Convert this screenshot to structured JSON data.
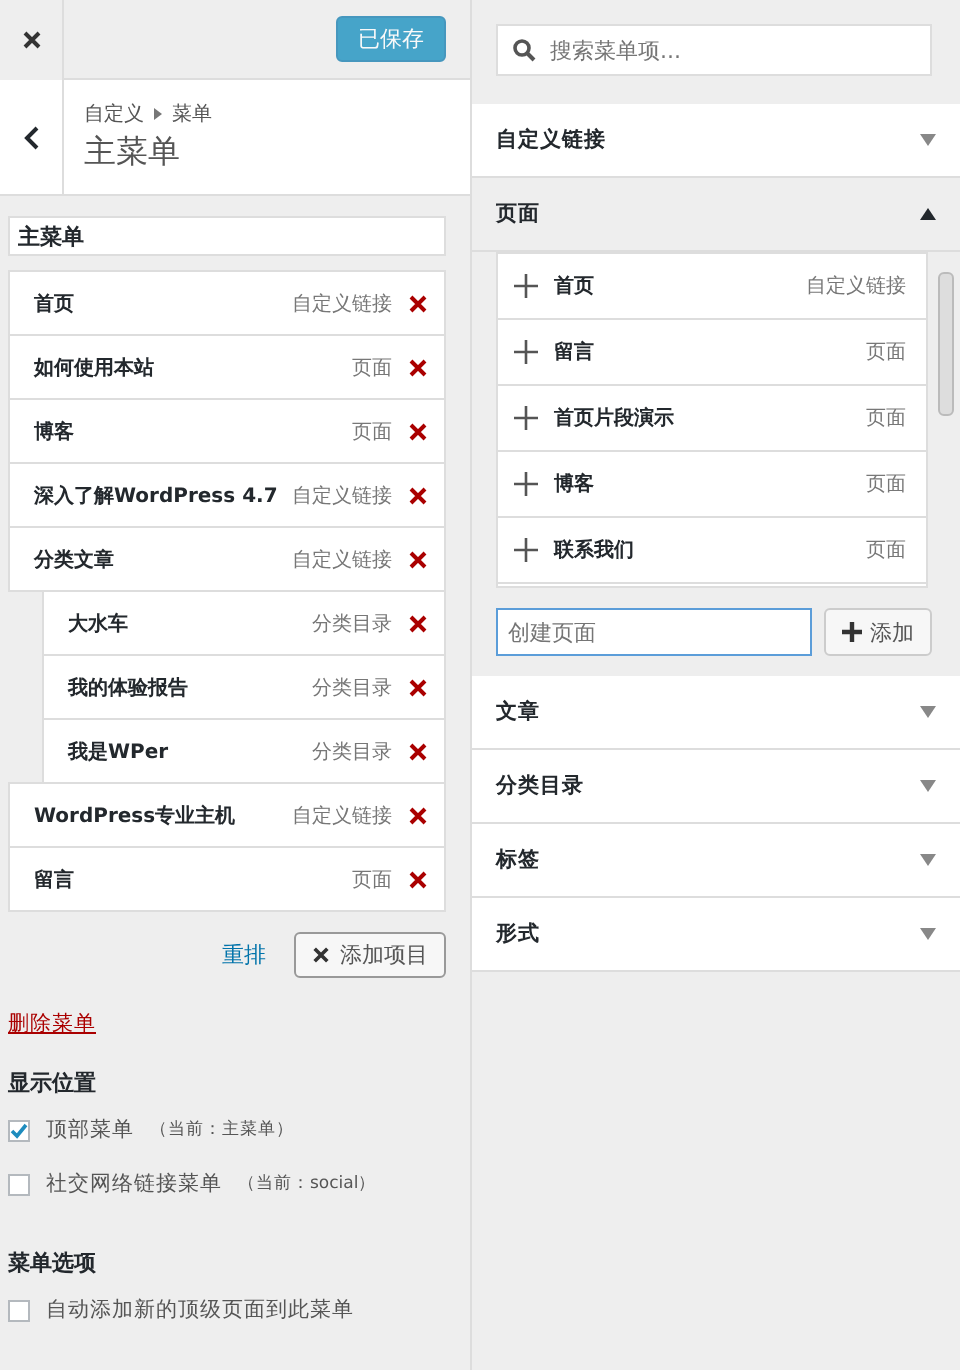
{
  "header": {
    "save_button": {
      "label": "已保存",
      "disabled": true
    }
  },
  "breadcrumb": {
    "parent": "自定义",
    "current": "菜单"
  },
  "title": "主菜单",
  "menu_name": {
    "value": "主菜单"
  },
  "menu_items": [
    {
      "title": "首页",
      "type": "自定义链接"
    },
    {
      "title": "如何使用本站",
      "type": "页面"
    },
    {
      "title": "博客",
      "type": "页面"
    },
    {
      "title": "深入了解WordPress 4.7",
      "type": "自定义链接"
    },
    {
      "title": "分类文章",
      "type": "自定义链接",
      "children": [
        {
          "title": "大水车",
          "type": "分类目录"
        },
        {
          "title": "我的体验报告",
          "type": "分类目录"
        },
        {
          "title": "我是WPer",
          "type": "分类目录"
        }
      ]
    },
    {
      "title": "WordPress专业主机",
      "type": "自定义链接"
    },
    {
      "title": "留言",
      "type": "页面"
    }
  ],
  "menu_actions": {
    "reorder": "重排",
    "add_items": "添加项目"
  },
  "delete_menu": "删除菜单",
  "display_location": {
    "heading": "显示位置",
    "locations": [
      {
        "label": "顶部菜单",
        "note": "（当前：主菜单）",
        "checked": true
      },
      {
        "label": "社交网络链接菜单",
        "note": "（当前：social）",
        "checked": false
      }
    ]
  },
  "menu_options": {
    "heading": "菜单选项",
    "options": [
      {
        "label": "自动添加新的顶级页面到此菜单",
        "checked": false
      }
    ]
  },
  "search": {
    "placeholder": "搜索菜单项..."
  },
  "sections": [
    {
      "title": "自定义链接",
      "expanded": false
    },
    {
      "title": "页面",
      "expanded": true,
      "items": [
        {
          "title": "首页",
          "type": "自定义链接"
        },
        {
          "title": "留言",
          "type": "页面"
        },
        {
          "title": "首页片段演示",
          "type": "页面"
        },
        {
          "title": "博客",
          "type": "页面"
        },
        {
          "title": "联系我们",
          "type": "页面"
        }
      ],
      "create_placeholder": "创建页面",
      "add_label": "添加"
    },
    {
      "title": "文章",
      "expanded": false
    },
    {
      "title": "分类目录",
      "expanded": false
    },
    {
      "title": "标签",
      "expanded": false
    },
    {
      "title": "形式",
      "expanded": false
    }
  ]
}
